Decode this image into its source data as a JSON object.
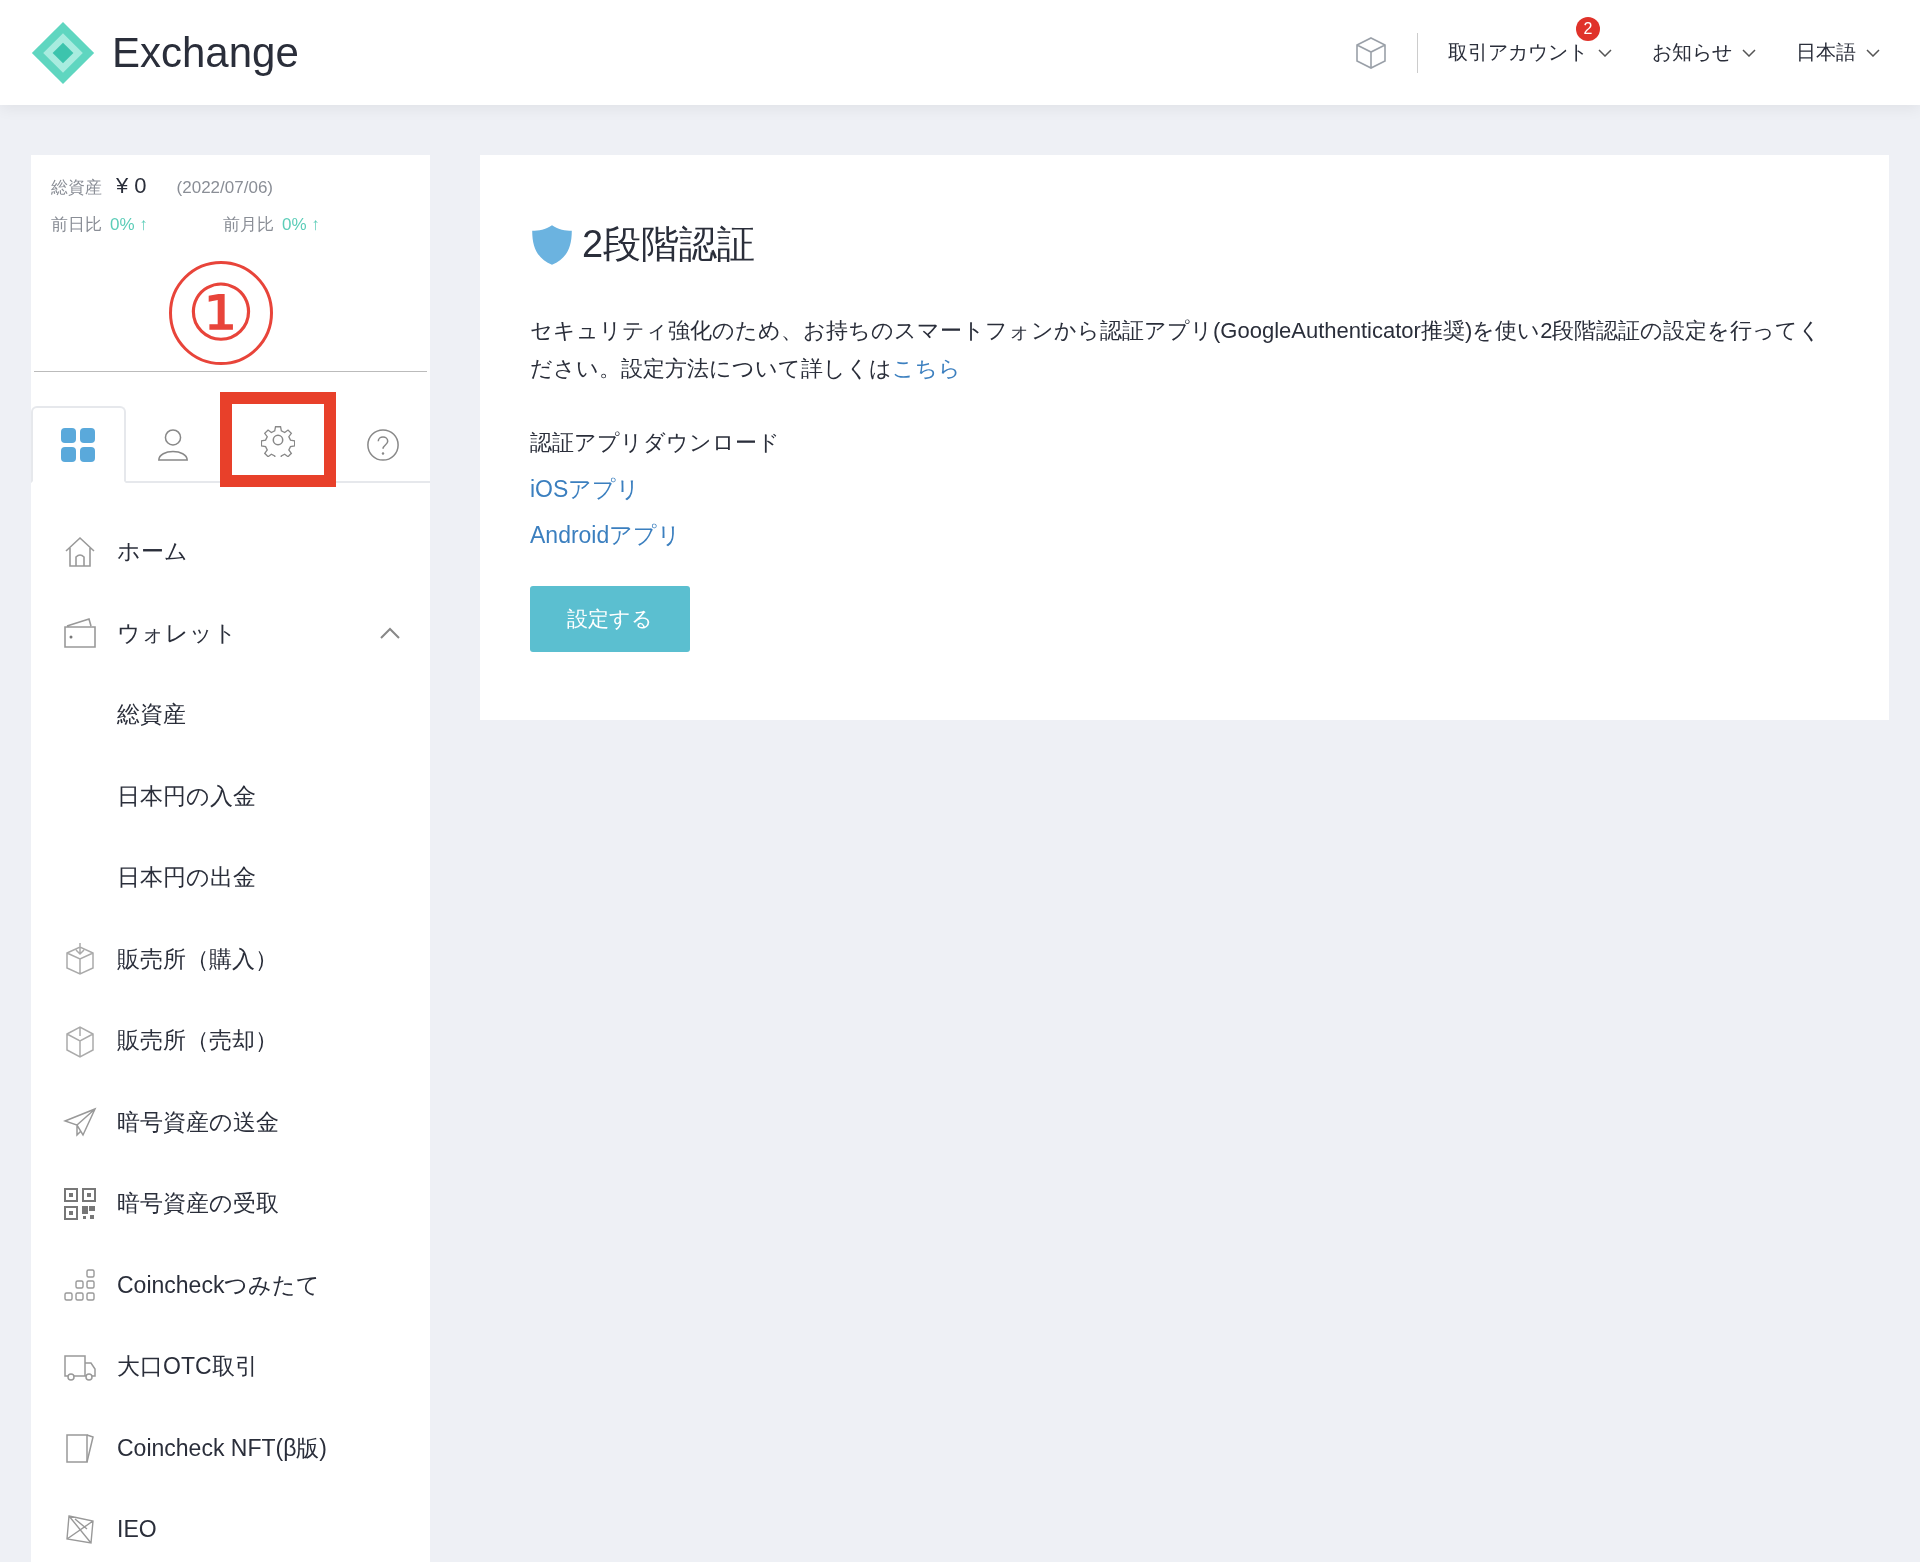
{
  "header": {
    "logo_text": "Exchange",
    "nav": [
      {
        "label": "取引アカウント",
        "badge": "2"
      },
      {
        "label": "お知らせ"
      },
      {
        "label": "日本語"
      }
    ]
  },
  "summary": {
    "total_label": "総資産",
    "total_value": "¥ 0",
    "date": "(2022/07/06)",
    "changes": [
      {
        "label": "前日比",
        "value": "0%",
        "arrow": "↑"
      },
      {
        "label": "前月比",
        "value": "0%",
        "arrow": "↑"
      }
    ]
  },
  "annotation": {
    "marker": "①"
  },
  "tabs": [
    {
      "kind": "grid",
      "selected": true,
      "highlighted": false
    },
    {
      "kind": "user",
      "selected": false,
      "highlighted": false
    },
    {
      "kind": "gear",
      "selected": false,
      "highlighted": true
    },
    {
      "kind": "help",
      "selected": false,
      "highlighted": false
    }
  ],
  "menu": [
    {
      "kind": "home",
      "label": "ホーム"
    },
    {
      "kind": "wallet",
      "label": "ウォレット",
      "expanded": true,
      "children": [
        {
          "label": "総資産"
        },
        {
          "label": "日本円の入金"
        },
        {
          "label": "日本円の出金"
        }
      ]
    },
    {
      "kind": "box-in",
      "label": "販売所（購入）"
    },
    {
      "kind": "box-out",
      "label": "販売所（売却）"
    },
    {
      "kind": "send",
      "label": "暗号資産の送金"
    },
    {
      "kind": "qr",
      "label": "暗号資産の受取"
    },
    {
      "kind": "stack",
      "label": "Coincheckつみたて"
    },
    {
      "kind": "truck",
      "label": "大口OTC取引"
    },
    {
      "kind": "card",
      "label": "Coincheck NFT(β版)"
    },
    {
      "kind": "ieo",
      "label": "IEO"
    }
  ],
  "content": {
    "title": "2段階認証",
    "description": "セキュリティ強化のため、お持ちのスマートフォンから認証アプリ(GoogleAuthenticator推奨)を使い2段階認証の設定を行ってください。設定方法について詳しくは",
    "description_link": "こちら",
    "download_heading": "認証アプリダウンロード",
    "links": [
      "iOSアプリ",
      "Androidアプリ"
    ],
    "button": "設定する"
  }
}
